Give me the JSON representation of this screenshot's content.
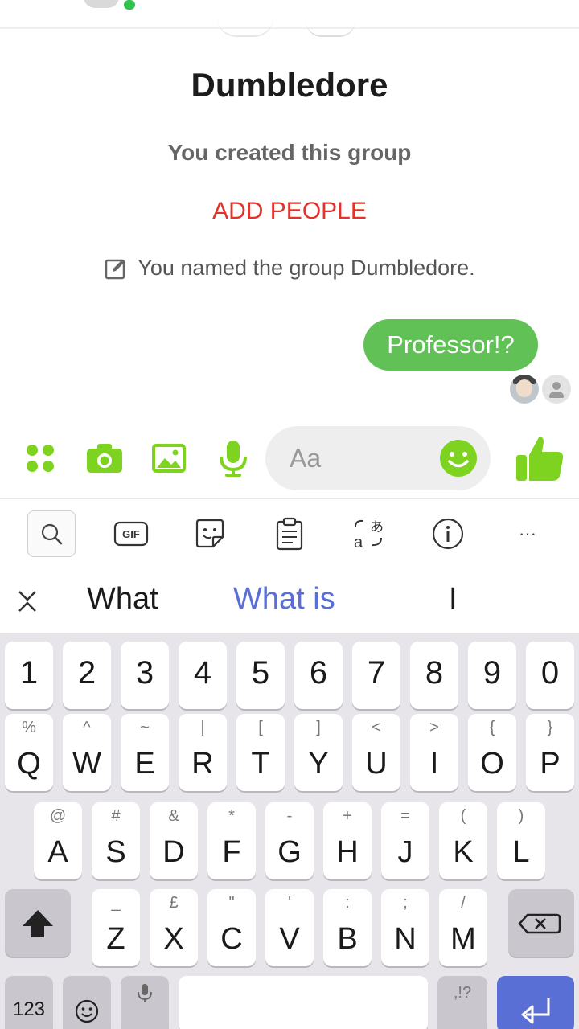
{
  "chat": {
    "group_name": "Dumbledore",
    "created_text": "You created this group",
    "add_people": "ADD PEOPLE",
    "named_text": "You named the group Dumbledore.",
    "message": "Professor!?"
  },
  "composer": {
    "placeholder": "Aa",
    "icons": [
      "apps-icon",
      "camera-icon",
      "gallery-icon",
      "microphone-icon",
      "emoji-icon",
      "thumbs-up-icon"
    ],
    "accent_color": "#7ed321"
  },
  "keyboard_toolbar": {
    "gif_label": "GIF",
    "more_label": "···"
  },
  "suggestions": [
    "What",
    "What is",
    "I"
  ],
  "keyboard": {
    "number_row": [
      "1",
      "2",
      "3",
      "4",
      "5",
      "6",
      "7",
      "8",
      "9",
      "0"
    ],
    "row1": [
      {
        "main": "Q",
        "sub": "%"
      },
      {
        "main": "W",
        "sub": "^"
      },
      {
        "main": "E",
        "sub": "~"
      },
      {
        "main": "R",
        "sub": "|"
      },
      {
        "main": "T",
        "sub": "["
      },
      {
        "main": "Y",
        "sub": "]"
      },
      {
        "main": "U",
        "sub": "<"
      },
      {
        "main": "I",
        "sub": ">"
      },
      {
        "main": "O",
        "sub": "{"
      },
      {
        "main": "P",
        "sub": "}"
      }
    ],
    "row2": [
      {
        "main": "A",
        "sub": "@"
      },
      {
        "main": "S",
        "sub": "#"
      },
      {
        "main": "D",
        "sub": "&"
      },
      {
        "main": "F",
        "sub": "*"
      },
      {
        "main": "G",
        "sub": "-"
      },
      {
        "main": "H",
        "sub": "+"
      },
      {
        "main": "J",
        "sub": "="
      },
      {
        "main": "K",
        "sub": "("
      },
      {
        "main": "L",
        "sub": ")"
      }
    ],
    "row3": [
      {
        "main": "Z",
        "sub": "_"
      },
      {
        "main": "X",
        "sub": "£"
      },
      {
        "main": "C",
        "sub": "\""
      },
      {
        "main": "V",
        "sub": "'"
      },
      {
        "main": "B",
        "sub": ":"
      },
      {
        "main": "N",
        "sub": ";"
      },
      {
        "main": "M",
        "sub": "/"
      }
    ],
    "symbols_label": "123",
    "punct_label": ",!?"
  }
}
